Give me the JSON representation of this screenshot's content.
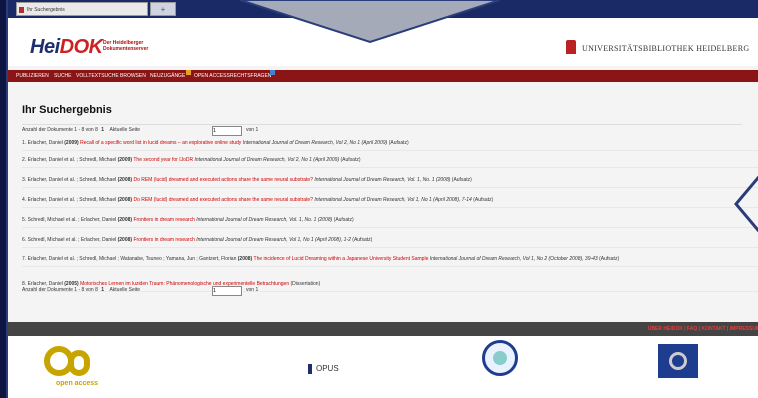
{
  "browser": {
    "tab_title": "Ihr Suchergebnis",
    "new_tab_label": "+"
  },
  "header": {
    "logo": {
      "part1": "Hei",
      "part2": "DOK"
    },
    "logo_sub1": "Der Heidelberger",
    "logo_sub2": "Dokumentenserver",
    "institution": "UNIVERSITÄTSBIBLIOTHEK HEIDELBERG"
  },
  "nav": {
    "items": [
      "PUBLIZIEREN",
      "SUCHE",
      "VOLLTEXTSUCHE",
      "BROWSEN",
      "NEUZUGÄNGE",
      "OPEN ACCESS",
      "RECHTSFRAGEN"
    ]
  },
  "main": {
    "title": "Ihr Suchergebnis",
    "count_label": "Anzahl der Dokumente 1 - 8 von 8",
    "page_number": "1",
    "current_page_label": "Aktuelle Seite",
    "page_input_value": "1",
    "of_pages": "von 1"
  },
  "results": [
    {
      "n": "1.",
      "authors": "Erlacher, Daniel",
      "year": "(2009)",
      "title": "Recall of a specific word list in lucid dreams – an explorative online study",
      "journal": "International Journal of Dream Research, Vol 2, No 1 (April 2009)",
      "type": "(Aufsatz)"
    },
    {
      "n": "2.",
      "authors": "Erlacher, Daniel et al. ; Schredl, Michael",
      "year": "(2009)",
      "title": "The second year for IJoDR",
      "journal": "International Journal of Dream Research, Vol 2, No 1 (April 2009)",
      "type": "(Aufsatz)"
    },
    {
      "n": "3.",
      "authors": "Erlacher, Daniel et al. ; Schredl, Michael",
      "year": "(2008)",
      "title": "Do REM (lucid) dreamed and executed actions share the same neural substrate?",
      "journal": "International Journal of Dream Research, Vol. 1, No. 1 (2008)",
      "type": "(Aufsatz)"
    },
    {
      "n": "4.",
      "authors": "Erlacher, Daniel et al. ; Schredl, Michael",
      "year": "(2008)",
      "title": "Do REM (lucid) dreamed and executed actions share the same neural substrate?",
      "journal": "International Journal of Dream Research, Vol 1, No 1 (April 2008), 7-14",
      "type": "(Aufsatz)"
    },
    {
      "n": "5.",
      "authors": "Schredl, Michael et al. ; Erlacher, Daniel",
      "year": "(2008)",
      "title": "Frontiers in dream research",
      "journal": "International Journal of Dream Research, Vol. 1, No. 1 (2008)",
      "type": "(Aufsatz)"
    },
    {
      "n": "6.",
      "authors": "Schredl, Michael et al. ; Erlacher, Daniel",
      "year": "(2008)",
      "title": "Frontiers in dream research",
      "journal": "International Journal of Dream Research, Vol 1, No 1 (April 2008), 1-2",
      "type": "(Aufsatz)"
    },
    {
      "n": "7.",
      "authors": "Erlacher, Daniel et al. ; Schredl, Michael ; Watanabe, Tsuneo ; Yamana, Jun ; Gantzert, Florian",
      "year": "(2008)",
      "title": "The incidence of Lucid Dreaming within a Japanese University Student Sample",
      "journal": "International Journal of Dream Research, Vol 1, No 2 (October 2008), 39-43",
      "type": "(Aufsatz)"
    },
    {
      "n": "8.",
      "authors": "Erlacher, Daniel",
      "year": "(2005)",
      "title": "Motorisches Lernen im luziden Traum: Phänomenologische und experimentelle Betrachtungen",
      "journal": "",
      "type": "(Dissertation)"
    }
  ],
  "footer": {
    "links": "ÜBER HEIDOK | FAQ | KONTAKT | IMPRESSUM"
  },
  "logos": {
    "open_access": "open access",
    "opus": "OPUS"
  },
  "colors": {
    "nav_bg": "#8b1515",
    "link": "#c00000",
    "brand_blue": "#1f2f6e",
    "oa_gold": "#c8a400"
  }
}
